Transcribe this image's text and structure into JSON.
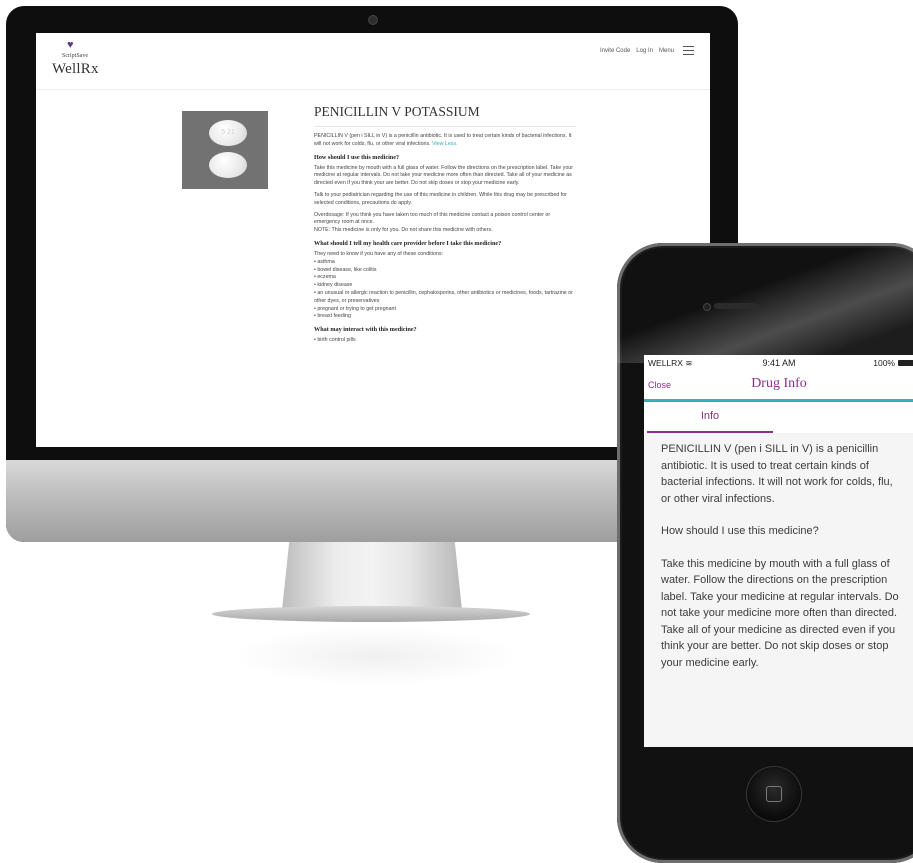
{
  "desktop": {
    "logo_small": "ScriptSave",
    "logo_big": "WellRx",
    "nav": {
      "invite": "Invite Code",
      "login": "Log In",
      "menu": "Menu"
    },
    "pill_imprint": "5 21",
    "drug_title": "PENICILLIN V POTASSIUM",
    "intro": "PENICILLIN V (pen i SILL in V) is a penicillin antibiotic. It is used to treat certain kinds of bacterial infections. It will not work for colds, flu, or other viral infections.",
    "view_less": "View Less.",
    "sections": {
      "use_heading": "How should I use this medicine?",
      "use_p1": "Take this medicine by mouth with a full glass of water. Follow the directions on the prescription label. Take your medicine at regular intervals. Do not take your medicine more often than directed. Take all of your medicine as directed even if you think your are better. Do not skip doses or stop your medicine early.",
      "use_p2": "Talk to your pediatrician regarding the use of this medicine in children. While this drug may be prescribed for selected conditions, precautions do apply.",
      "use_p3": "Overdosage: If you think you have taken too much of this medicine contact a poison control center or emergency room at once.",
      "use_p4": "NOTE: This medicine is only for you. Do not share this medicine with others.",
      "provider_heading": "What should I tell my health care provider before I take this medicine?",
      "provider_intro": "They need to know if you have any of these conditions:",
      "conditions": [
        "• asthma",
        "• bowel disease, like colitis",
        "• eczema",
        "• kidney disease",
        "• an unusual or allergic reaction to penicillin, cephalosporins, other antibiotics or medicines, foods, tartrazine or other dyes, or preservatives",
        "• pregnant or trying to get pregnant",
        "• breast feeding"
      ],
      "interact_heading": "What may interact with this medicine?",
      "interactions": [
        "• birth control pills"
      ]
    }
  },
  "phone": {
    "status": {
      "carrier": "WELLRX",
      "time": "9:41 AM",
      "battery": "100%"
    },
    "nav": {
      "close": "Close",
      "title": "Drug Info"
    },
    "tab": "Info",
    "intro": "PENICILLIN V (pen i SILL in V) is a penicillin antibiotic. It is used to treat certain kinds of bacterial infections. It will not work for colds, flu, or other viral infections.",
    "question": "How should I use this medicine?",
    "answer": "Take this medicine by mouth with a full glass of water. Follow the directions on the prescription label. Take your medicine at regular intervals. Do not take your medicine more often than directed. Take all of your medicine as directed even if you think your are better. Do not skip doses or stop your medicine early."
  },
  "colors": {
    "accent": "#8b2f8f",
    "teal": "#2fb3b4"
  }
}
